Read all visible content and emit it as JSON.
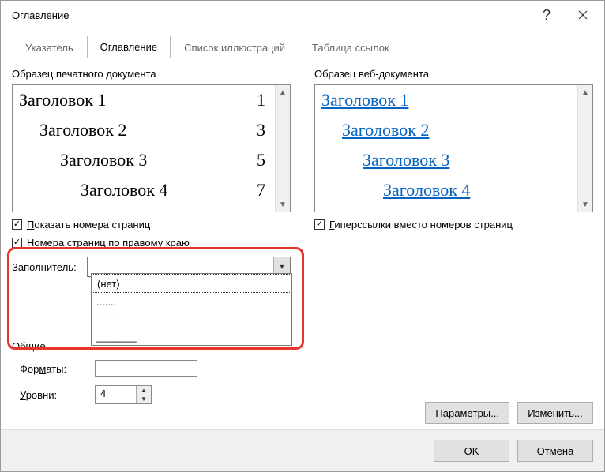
{
  "title": "Оглавление",
  "tabs": [
    "Указатель",
    "Оглавление",
    "Список иллюстраций",
    "Таблица ссылок"
  ],
  "active_tab": 1,
  "print_preview": {
    "label": "Образец печатного документа",
    "items": [
      {
        "text": "Заголовок 1",
        "page": "1",
        "indent": 0
      },
      {
        "text": "Заголовок 2",
        "page": "3",
        "indent": 1
      },
      {
        "text": "Заголовок 3",
        "page": "5",
        "indent": 2
      },
      {
        "text": "Заголовок 4",
        "page": "7",
        "indent": 3
      }
    ]
  },
  "web_preview": {
    "label": "Образец веб-документа",
    "items": [
      {
        "text": "Заголовок 1",
        "indent": 0
      },
      {
        "text": "Заголовок 2",
        "indent": 1
      },
      {
        "text": "Заголовок 3",
        "indent": 2
      },
      {
        "text": "Заголовок 4",
        "indent": 3
      }
    ]
  },
  "checkboxes": {
    "show_page_numbers": "Показать номера страниц",
    "right_align": "Номера страниц по правому краю",
    "hyperlinks": "Гиперссылки вместо номеров страниц"
  },
  "fill": {
    "label": "Заполнитель:",
    "value": "",
    "options": [
      "(нет)",
      ".......",
      "-------",
      "_______"
    ]
  },
  "general": {
    "heading": "Общие",
    "formats_label": "Форматы:",
    "formats_value": "",
    "levels_label": "Уровни:",
    "levels_value": "4"
  },
  "buttons": {
    "params": "Параметры...",
    "modify": "Изменить...",
    "ok": "OK",
    "cancel": "Отмена"
  }
}
